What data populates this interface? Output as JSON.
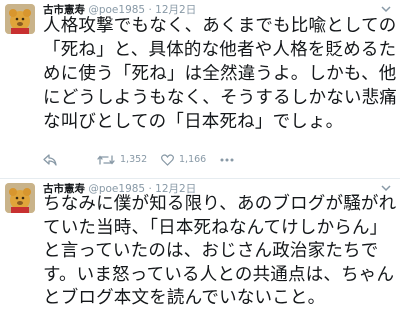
{
  "tweets": [
    {
      "name": "古市憲寿",
      "handle": "@poe1985",
      "separator": "·",
      "date": "12月2日",
      "text": "人格攻撃でもなく、あくまでも比喩としての「死ね」と、具体的な他者や人格を貶めるために使う「死ね」は全然違うよ。しかも、他にどうしようもなく、そうするしかない悲痛な叫びとしての「日本死ね」でしょ。",
      "retweets": "1,352",
      "likes": "1,166"
    },
    {
      "name": "古市憲寿",
      "handle": "@poe1985",
      "separator": "·",
      "date": "12月2日",
      "text": "ちなみに僕が知る限り、あのブログが騒がれていた当時、「日本死ねなんてけしからん」と言っていたのは、おじさん政治家たちです。いま怒っている人との共通点は、ちゃんとブログ本文を読んでいないこと。"
    }
  ],
  "icons": {
    "reply": "reply-icon",
    "retweet": "retweet-icon",
    "like": "heart-icon",
    "more": "more-icon",
    "menu": "chevron-down-icon"
  },
  "colors": {
    "text": "#14171a",
    "muted": "#8899a6",
    "divider": "#e6ecf0"
  }
}
